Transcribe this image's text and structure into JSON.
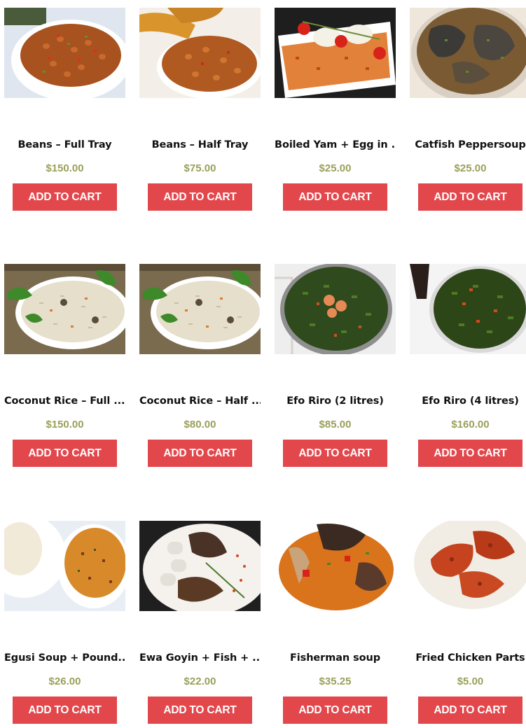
{
  "colors": {
    "button_bg": "#e2474c",
    "button_text": "#ffffff",
    "price": "#9aa05a",
    "title": "#111111"
  },
  "products": [
    {
      "name": "Beans – Full Tray",
      "price": "$150.00",
      "button": "ADD TO CART",
      "image": "beans-full-tray-image"
    },
    {
      "name": "Beans – Half Tray",
      "price": "$75.00",
      "button": "ADD TO CART",
      "image": "beans-half-tray-image"
    },
    {
      "name": "Boiled Yam + Egg in ...",
      "price": "$25.00",
      "button": "ADD TO CART",
      "image": "boiled-yam-egg-image"
    },
    {
      "name": "Catfish Peppersoup",
      "price": "$25.00",
      "button": "ADD TO CART",
      "image": "catfish-peppersoup-image"
    },
    {
      "name": "Coconut Rice – Full ...",
      "price": "$150.00",
      "button": "ADD TO CART",
      "image": "coconut-rice-full-image"
    },
    {
      "name": "Coconut Rice – Half ...",
      "price": "$80.00",
      "button": "ADD TO CART",
      "image": "coconut-rice-half-image"
    },
    {
      "name": "Efo Riro (2 litres)",
      "price": "$85.00",
      "button": "ADD TO CART",
      "image": "efo-riro-2l-image"
    },
    {
      "name": "Efo Riro (4 litres)",
      "price": "$160.00",
      "button": "ADD TO CART",
      "image": "efo-riro-4l-image"
    },
    {
      "name": "Egusi Soup + Pound...",
      "price": "$26.00",
      "button": "ADD TO CART",
      "image": "egusi-soup-image"
    },
    {
      "name": "Ewa Goyin + Fish + ...",
      "price": "$22.00",
      "button": "ADD TO CART",
      "image": "ewa-goyin-image"
    },
    {
      "name": "Fisherman soup",
      "price": "$35.25",
      "button": "ADD TO CART",
      "image": "fisherman-soup-image"
    },
    {
      "name": "Fried Chicken Parts",
      "price": "$5.00",
      "button": "ADD TO CART",
      "image": "fried-chicken-image"
    }
  ]
}
